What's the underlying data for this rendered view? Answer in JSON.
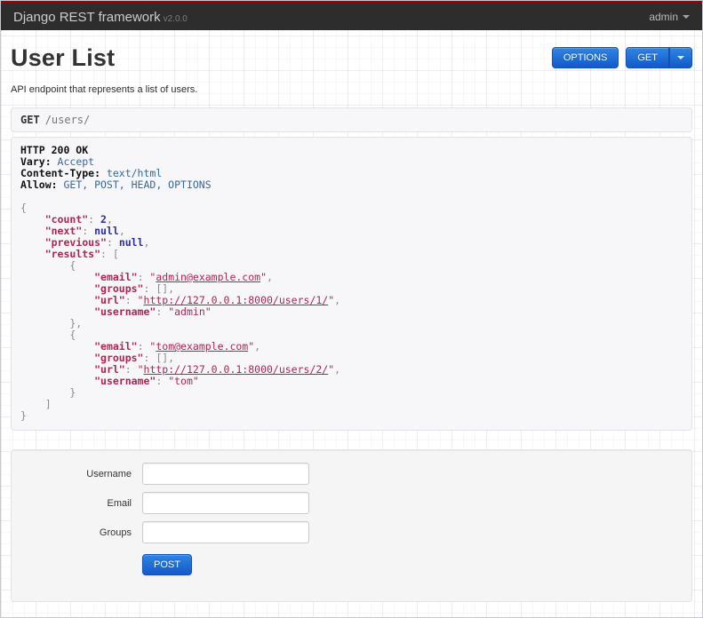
{
  "navbar": {
    "brand": "Django REST framework",
    "version": "v2.0.0",
    "user_menu": "admin"
  },
  "header": {
    "title": "User List",
    "description": "API endpoint that represents a list of users.",
    "options_button": "OPTIONS",
    "get_button": "GET"
  },
  "request": {
    "method": "GET",
    "path": "/users/"
  },
  "response": {
    "status_line": "HTTP 200 OK",
    "headers": {
      "Vary": "Accept",
      "Content-Type": "text/html",
      "Allow": "GET, POST, HEAD, OPTIONS"
    },
    "body": {
      "count": 2,
      "next": null,
      "previous": null,
      "results": [
        {
          "email": "admin@example.com",
          "groups": [],
          "url": "http://127.0.0.1:8000/users/1/",
          "username": "admin"
        },
        {
          "email": "tom@example.com",
          "groups": [],
          "url": "http://127.0.0.1:8000/users/2/",
          "username": "tom"
        }
      ]
    },
    "lines": [
      [
        [
          "b",
          "HTTP 200 OK"
        ]
      ],
      [
        [
          "b",
          "Vary:"
        ],
        [
          "hv",
          " Accept"
        ]
      ],
      [
        [
          "b",
          "Content-Type:"
        ],
        [
          "hv",
          " text/html"
        ]
      ],
      [
        [
          "b",
          "Allow:"
        ],
        [
          "hv",
          " GET, POST, HEAD, OPTIONS"
        ]
      ],
      [],
      [
        [
          "p",
          "{"
        ]
      ],
      [
        [
          "p",
          "    "
        ],
        [
          "k",
          "\"count\""
        ],
        [
          "p",
          ": "
        ],
        [
          "n",
          "2"
        ],
        [
          "p",
          ","
        ]
      ],
      [
        [
          "p",
          "    "
        ],
        [
          "k",
          "\"next\""
        ],
        [
          "p",
          ": "
        ],
        [
          "n",
          "null"
        ],
        [
          "p",
          ","
        ]
      ],
      [
        [
          "p",
          "    "
        ],
        [
          "k",
          "\"previous\""
        ],
        [
          "p",
          ": "
        ],
        [
          "n",
          "null"
        ],
        [
          "p",
          ","
        ]
      ],
      [
        [
          "p",
          "    "
        ],
        [
          "k",
          "\"results\""
        ],
        [
          "p",
          ": ["
        ]
      ],
      [
        [
          "p",
          "        {"
        ]
      ],
      [
        [
          "p",
          "            "
        ],
        [
          "k",
          "\"email\""
        ],
        [
          "p",
          ": "
        ],
        [
          "s",
          "\""
        ],
        [
          "a",
          "admin@example.com"
        ],
        [
          "s",
          "\""
        ],
        [
          "p",
          ","
        ]
      ],
      [
        [
          "p",
          "            "
        ],
        [
          "k",
          "\"groups\""
        ],
        [
          "p",
          ": [],"
        ]
      ],
      [
        [
          "p",
          "            "
        ],
        [
          "k",
          "\"url\""
        ],
        [
          "p",
          ": "
        ],
        [
          "s",
          "\""
        ],
        [
          "a",
          "http://127.0.0.1:8000/users/1/"
        ],
        [
          "s",
          "\""
        ],
        [
          "p",
          ","
        ]
      ],
      [
        [
          "p",
          "            "
        ],
        [
          "k",
          "\"username\""
        ],
        [
          "p",
          ": "
        ],
        [
          "s",
          "\"admin\""
        ]
      ],
      [
        [
          "p",
          "        },"
        ]
      ],
      [
        [
          "p",
          "        {"
        ]
      ],
      [
        [
          "p",
          "            "
        ],
        [
          "k",
          "\"email\""
        ],
        [
          "p",
          ": "
        ],
        [
          "s",
          "\""
        ],
        [
          "a",
          "tom@example.com"
        ],
        [
          "s",
          "\""
        ],
        [
          "p",
          ","
        ]
      ],
      [
        [
          "p",
          "            "
        ],
        [
          "k",
          "\"groups\""
        ],
        [
          "p",
          ": [],"
        ]
      ],
      [
        [
          "p",
          "            "
        ],
        [
          "k",
          "\"url\""
        ],
        [
          "p",
          ": "
        ],
        [
          "s",
          "\""
        ],
        [
          "a",
          "http://127.0.0.1:8000/users/2/"
        ],
        [
          "s",
          "\""
        ],
        [
          "p",
          ","
        ]
      ],
      [
        [
          "p",
          "            "
        ],
        [
          "k",
          "\"username\""
        ],
        [
          "p",
          ": "
        ],
        [
          "s",
          "\"tom\""
        ]
      ],
      [
        [
          "p",
          "        }"
        ]
      ],
      [
        [
          "p",
          "    ]"
        ]
      ],
      [
        [
          "p",
          "}"
        ]
      ]
    ]
  },
  "form": {
    "fields": [
      {
        "name": "username",
        "label": "Username",
        "value": ""
      },
      {
        "name": "email",
        "label": "Email",
        "value": ""
      },
      {
        "name": "groups",
        "label": "Groups",
        "value": ""
      }
    ],
    "submit_label": "POST"
  },
  "colors": {
    "accent_blue": "#1459c9",
    "navbar_background": "#2d2d2d",
    "navbar_top_stripe": "#9f0000",
    "json_key": "#b0254f",
    "json_literal": "#2b2bad",
    "header_value_blue": "#36699e",
    "panel_background": "#f7f7f9",
    "well_background": "#f5f5f5"
  }
}
